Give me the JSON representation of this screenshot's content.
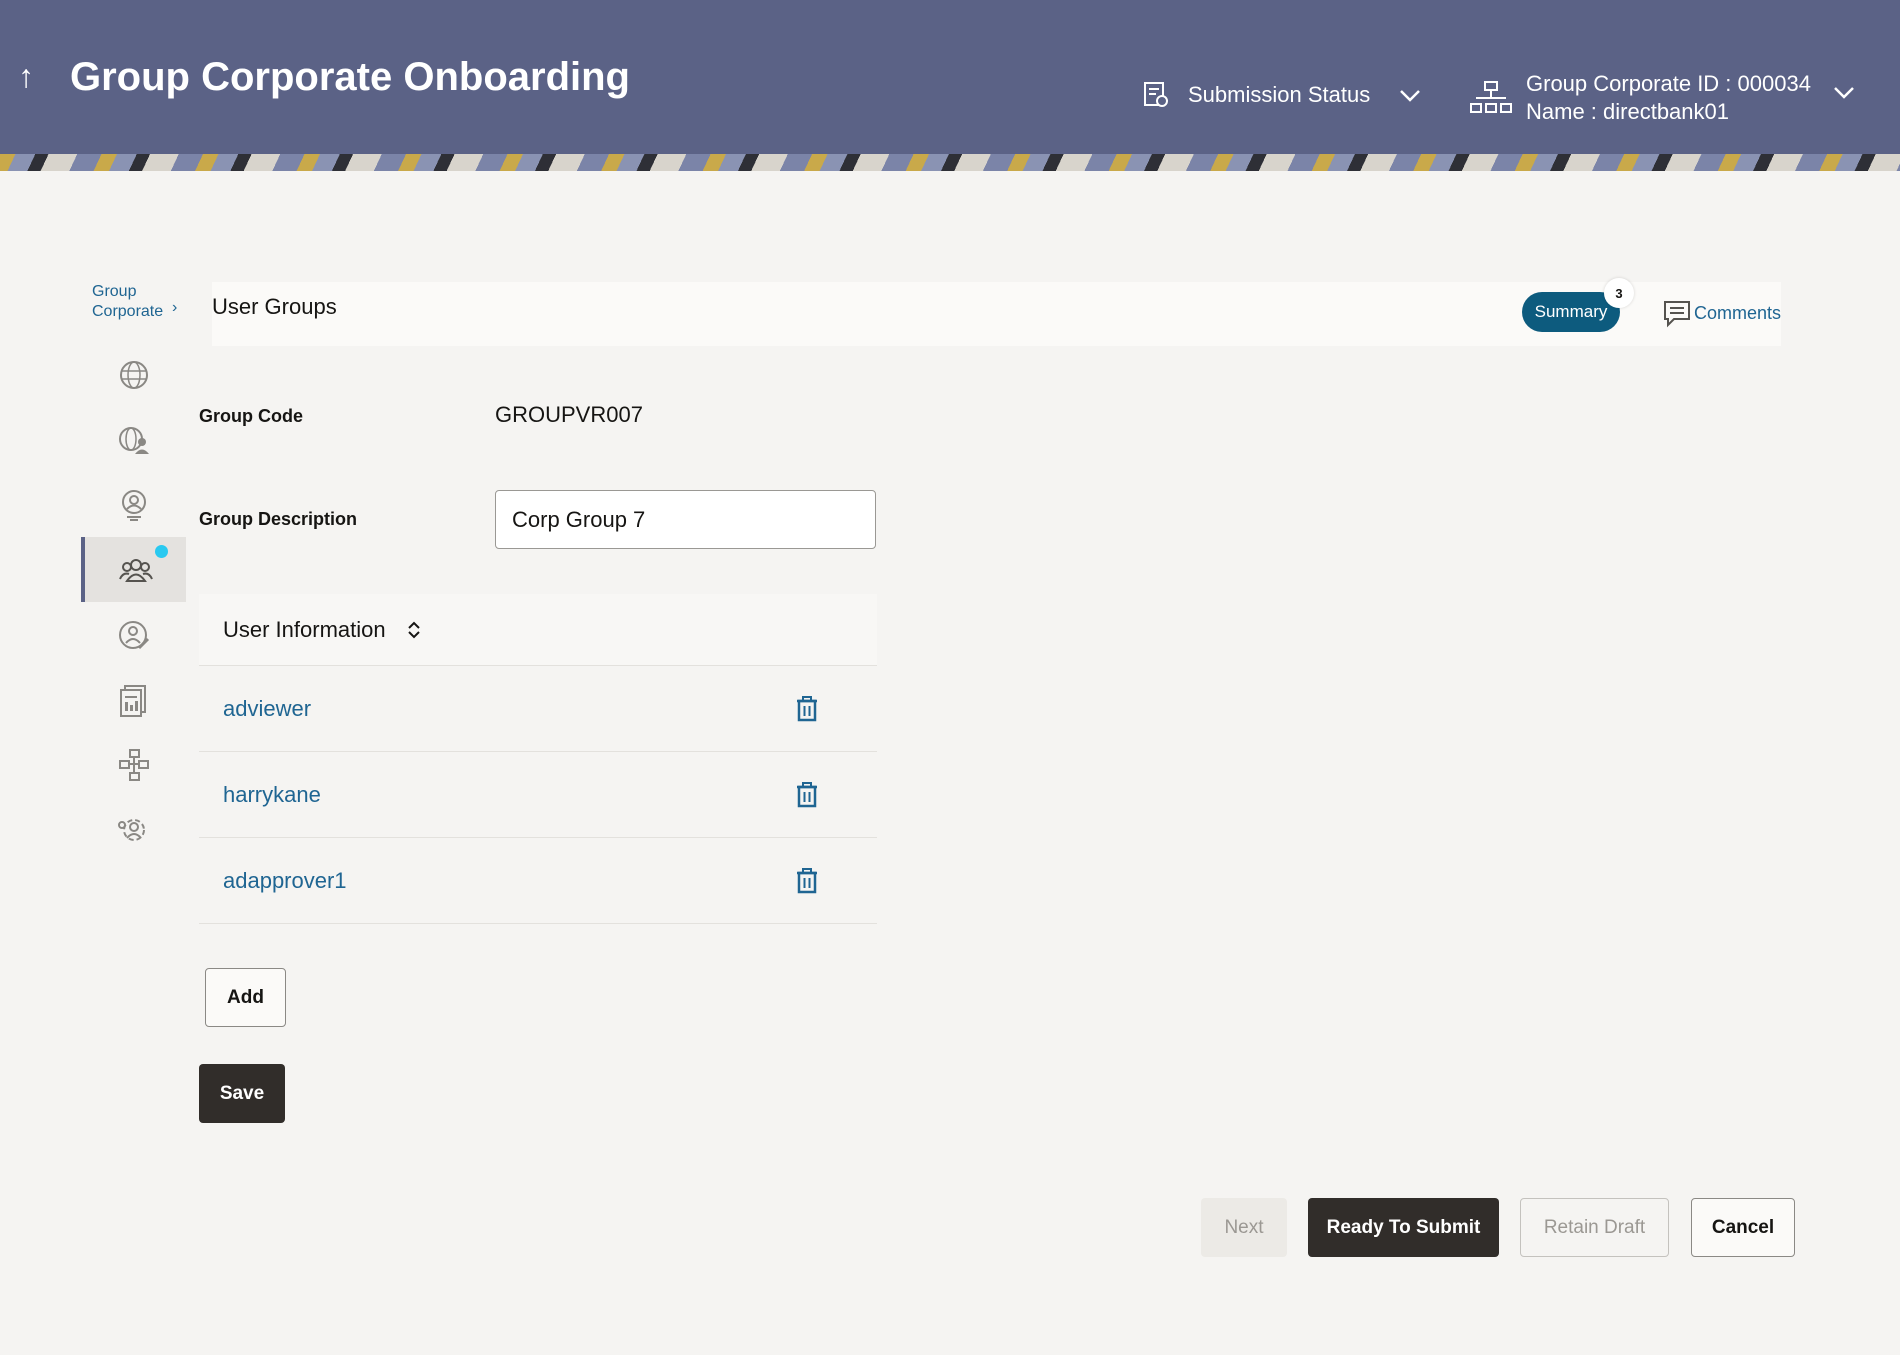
{
  "header": {
    "back_icon": "up-arrow-icon",
    "title": "Group Corporate Onboarding",
    "submission_status_label": "Submission Status",
    "corporate_id_line": "Group Corporate ID : 000034",
    "corporate_name_line": "Name : directbank01"
  },
  "sidebar": {
    "breadcrumb_line1": "Group",
    "breadcrumb_line2": "Corporate",
    "breadcrumb_arrow": "›",
    "items": [
      {
        "icon": "globe-icon"
      },
      {
        "icon": "globe-users-icon"
      },
      {
        "icon": "user-profile-icon"
      },
      {
        "icon": "user-group-icon",
        "active": true
      },
      {
        "icon": "user-edit-icon"
      },
      {
        "icon": "report-icon"
      },
      {
        "icon": "workflow-icon"
      },
      {
        "icon": "settings-users-icon"
      }
    ]
  },
  "tabbar": {
    "title": "User Groups",
    "summary_label": "Summary",
    "summary_count": "3",
    "comments_label": "Comments"
  },
  "form": {
    "group_code_label": "Group Code",
    "group_code_value": "GROUPVR007",
    "group_description_label": "Group Description",
    "group_description_value": "Corp Group 7"
  },
  "user_table": {
    "header": "User Information",
    "sort_icon": "⌃⌄",
    "rows": [
      "adviewer",
      "harrykane",
      "adapprover1"
    ]
  },
  "buttons": {
    "add": "Add",
    "save": "Save",
    "next": "Next",
    "ready_to_submit": "Ready To Submit",
    "retain_draft": "Retain Draft",
    "cancel": "Cancel"
  }
}
